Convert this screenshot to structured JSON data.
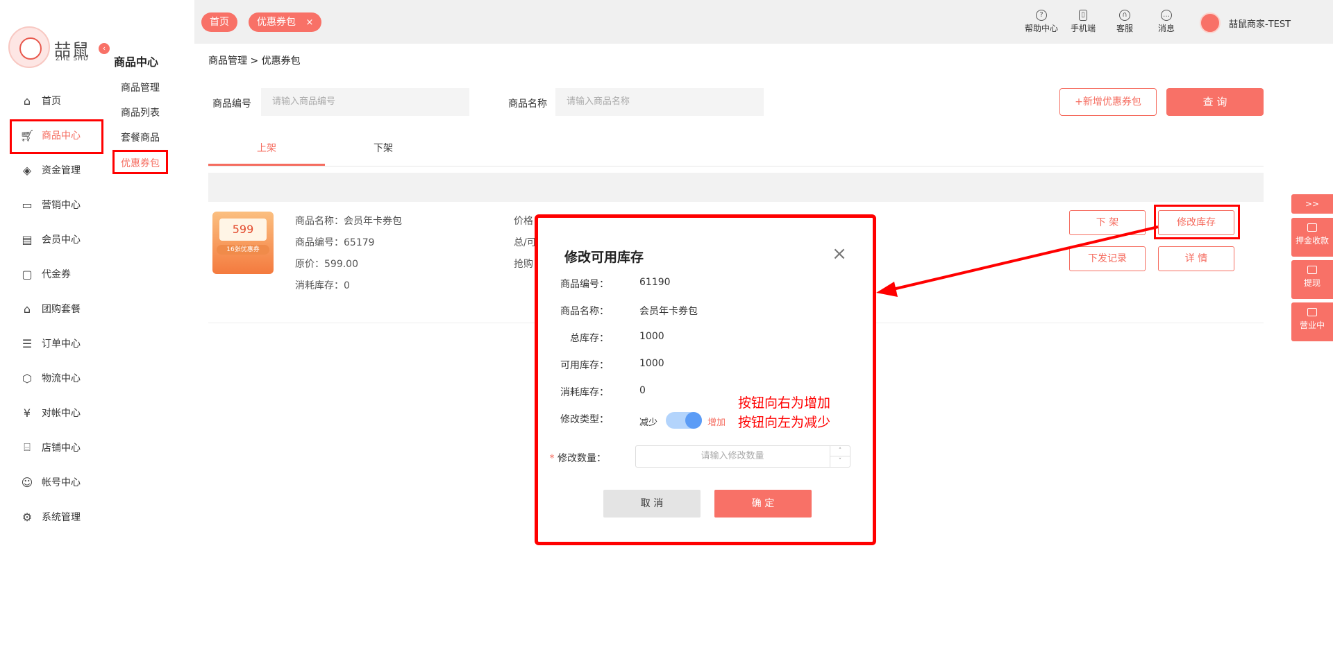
{
  "brand": {
    "name": "喆鼠",
    "sub": "ZHE SHU"
  },
  "nav": {
    "items": [
      {
        "label": "首页",
        "icon": "home-icon"
      },
      {
        "label": "商品中心",
        "icon": "cart-icon"
      },
      {
        "label": "资金管理",
        "icon": "layers-icon"
      },
      {
        "label": "营销中心",
        "icon": "marketing-icon"
      },
      {
        "label": "会员中心",
        "icon": "vip-card-icon"
      },
      {
        "label": "代金券",
        "icon": "voucher-icon"
      },
      {
        "label": "团购套餐",
        "icon": "group-buy-icon"
      },
      {
        "label": "订单中心",
        "icon": "order-icon"
      },
      {
        "label": "物流中心",
        "icon": "box-icon"
      },
      {
        "label": "对帐中心",
        "icon": "yen-icon"
      },
      {
        "label": "店铺中心",
        "icon": "store-icon"
      },
      {
        "label": "帐号中心",
        "icon": "user-icon"
      },
      {
        "label": "系统管理",
        "icon": "settings-icon"
      }
    ]
  },
  "subnav": {
    "title": "商品中心",
    "items": [
      "商品管理",
      "商品列表",
      "套餐商品",
      "优惠券包"
    ]
  },
  "topbar": {
    "tabs": [
      {
        "label": "首页"
      },
      {
        "label": "优惠券包",
        "close": "×"
      }
    ],
    "actions": [
      {
        "label": "帮助中心",
        "icon": "help-icon",
        "glyph": "?"
      },
      {
        "label": "手机端",
        "icon": "phone-icon",
        "glyph": "▯"
      },
      {
        "label": "客服",
        "icon": "headset-icon",
        "glyph": "∩"
      },
      {
        "label": "消息",
        "icon": "message-icon",
        "glyph": "…"
      }
    ],
    "user": "喆鼠商家-TEST"
  },
  "breadcrumb": "商品管理 > 优惠券包",
  "search": {
    "code_label": "商品编号",
    "code_placeholder": "请输入商品编号",
    "name_label": "商品名称",
    "name_placeholder": "请输入商品名称",
    "add_button": "+新增优惠券包",
    "query_button": "查 询"
  },
  "tabs": [
    "上架",
    "下架"
  ],
  "product": {
    "image_price": "599",
    "image_sub": "16张优惠券",
    "name": "商品名称：会员年卡券包",
    "code": "商品编号：65179",
    "original_price": "原价：599.00",
    "consumed": "消耗库存：0",
    "col2": [
      "价格",
      "总/可",
      "抢购"
    ],
    "buttons": {
      "offshelf": "下 架",
      "edit_stock": "修改库存",
      "records": "下发记录",
      "detail": "详 情"
    }
  },
  "float_panel": {
    "toggle": ">>",
    "items": [
      {
        "label": "押金收款",
        "icon": "card-icon"
      },
      {
        "label": "提现",
        "icon": "withdraw-icon"
      },
      {
        "label": "营业中",
        "icon": "shop-icon"
      }
    ]
  },
  "modal": {
    "title": "修改可用库存",
    "close": "×",
    "fields": [
      {
        "label": "商品编号：",
        "value": "61190"
      },
      {
        "label": "商品名称：",
        "value": "会员年卡券包"
      },
      {
        "label": "总库存：",
        "value": "1000"
      },
      {
        "label": "可用库存：",
        "value": "1000"
      },
      {
        "label": "消耗库存：",
        "value": "0"
      }
    ],
    "type_label": "修改类型：",
    "type_off": "减少",
    "type_on": "增加",
    "qty_required": "*",
    "qty_label": "修改数量：",
    "qty_placeholder": "请输入修改数量",
    "cancel": "取 消",
    "confirm": "确 定",
    "annotation": [
      "按钮向右为增加",
      "按钮向左为减少"
    ]
  },
  "colors": {
    "accent": "#f87167",
    "highlight": "#ff0000",
    "toggle": "#5b9cf6"
  }
}
